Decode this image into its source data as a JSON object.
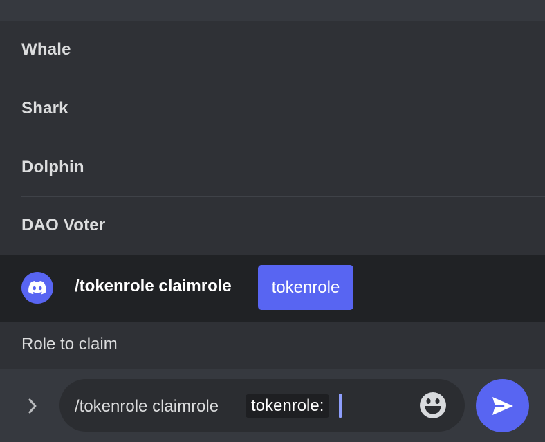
{
  "role_options": [
    {
      "label": "Whale"
    },
    {
      "label": "Shark"
    },
    {
      "label": "Dolphin"
    },
    {
      "label": "DAO Voter"
    }
  ],
  "command_suggestion": {
    "bot_icon": "discord-logo-icon",
    "command": "/tokenrole claimrole",
    "parameter": "tokenrole",
    "parameter_description": "Role to claim"
  },
  "composer": {
    "expand_icon": "chevron-right-icon",
    "command_text": "/tokenrole claimrole",
    "option_chip": "tokenrole:",
    "emoji_icon": "smile-icon",
    "send_icon": "send-icon"
  },
  "colors": {
    "accent": "#5865f2",
    "background": "#36393f",
    "panel": "#2f3136",
    "dark_row": "#202225"
  }
}
